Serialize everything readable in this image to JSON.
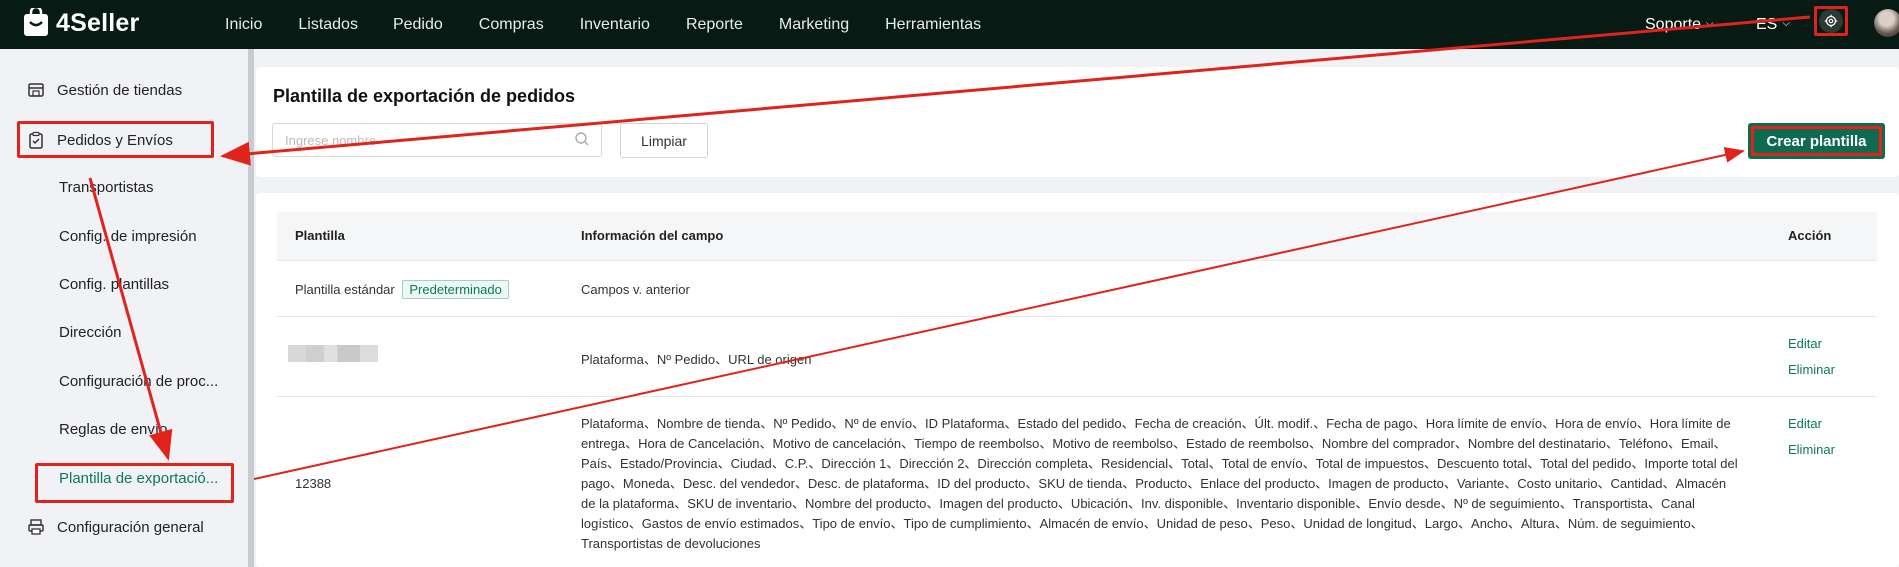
{
  "brand": {
    "name": "4Seller"
  },
  "nav": [
    "Inicio",
    "Listados",
    "Pedido",
    "Compras",
    "Inventario",
    "Reporte",
    "Marketing",
    "Herramientas"
  ],
  "topbar": {
    "support": "Soporte",
    "language": "ES"
  },
  "sidebar": {
    "items": [
      {
        "label": "Gestión de tiendas",
        "icon": "store-icon"
      },
      {
        "label": "Pedidos y Envíos",
        "icon": "clipboard-icon"
      },
      {
        "label": "Configuración general",
        "icon": "printer-icon"
      }
    ],
    "sub_items": [
      "Transportistas",
      "Config. de impresión",
      "Config. plantillas",
      "Dirección",
      "Configuración de proc...",
      "Reglas de envío",
      "Plantilla de exportació..."
    ]
  },
  "page": {
    "title": "Plantilla de exportación de pedidos",
    "search_placeholder": "Ingrese nombre",
    "clear_label": "Limpiar",
    "create_label": "Crear plantilla"
  },
  "table": {
    "headers": [
      "Plantilla",
      "Información del campo",
      "Acción"
    ],
    "rows": [
      {
        "name": "Plantilla estándar",
        "tag": "Predeterminado",
        "fields": "Campos v. anterior",
        "actions": []
      },
      {
        "name": "",
        "fields": "Plataforma、Nº Pedido、URL de origen",
        "actions": [
          "Editar",
          "Eliminar"
        ]
      },
      {
        "name": "12388",
        "fields": "Plataforma、Nombre de tienda、Nº Pedido、Nº de envío、ID Plataforma、Estado del pedido、Fecha de creación、Últ. modif.、Fecha de pago、Hora límite de envío、Hora de envío、Hora límite de entrega、Hora de Cancelación、Motivo de cancelación、Tiempo de reembolso、Motivo de reembolso、Estado de reembolso、Nombre del comprador、Nombre del destinatario、Teléfono、Email、País、Estado/Provincia、Ciudad、C.P.、Dirección 1、Dirección 2、Dirección completa、Residencial、Total、Total de envío、Total de impuestos、Descuento total、Total del pedido、Importe total del pago、Moneda、Desc. del vendedor、Desc. de plataforma、ID del producto、SKU de tienda、Producto、Enlace del producto、Imagen de producto、Variante、Costo unitario、Cantidad、Almacén de la plataforma、SKU de inventario、Nombre del producto、Imagen del producto、Ubicación、Inv. disponible、Inventario disponible、Envío desde、Nº de seguimiento、Transportista、Canal logístico、Gastos de envío estimados、Tipo de envío、Tipo de cumplimiento、Almacén de envío、Unidad de peso、Peso、Unidad de longitud、Largo、Ancho、Altura、Núm. de seguimiento、Transportistas de devoluciones",
        "actions": [
          "Editar",
          "Eliminar"
        ]
      }
    ]
  },
  "colors": {
    "accent": "#0e6b4f",
    "annotation": "#e0231c",
    "topbar": "#071a14"
  }
}
